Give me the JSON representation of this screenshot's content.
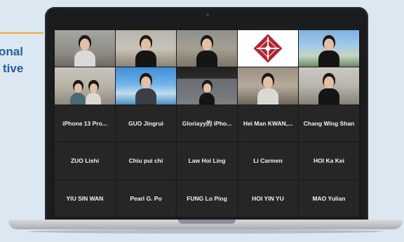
{
  "brand": {
    "line1": "onal",
    "line2": "tive",
    "accent_color": "#1f5fa8",
    "stripe_color": "#f0a830"
  },
  "meeting": {
    "video_tiles": [
      {
        "id": "p1",
        "icon": "participant-video"
      },
      {
        "id": "p2",
        "icon": "participant-video"
      },
      {
        "id": "p3",
        "icon": "participant-video"
      },
      {
        "id": "p4",
        "icon": "university-logo"
      },
      {
        "id": "p5",
        "icon": "participant-video"
      },
      {
        "id": "p6",
        "icon": "participant-video"
      },
      {
        "id": "p7",
        "icon": "participant-video"
      },
      {
        "id": "p8",
        "icon": "participant-video"
      },
      {
        "id": "p9",
        "icon": "participant-video"
      },
      {
        "id": "p10",
        "icon": "participant-video"
      }
    ],
    "name_tiles": [
      {
        "name": "iPhone 13 Pro..."
      },
      {
        "name": "GUO Jingrui"
      },
      {
        "name": "Gloriayy的 iPho..."
      },
      {
        "name": "Hei Man KWAN,..."
      },
      {
        "name": "Chang Wing Shan"
      },
      {
        "name": "ZUO Lishi"
      },
      {
        "name": "Chiu pui chi"
      },
      {
        "name": "Law Hoi Ling"
      },
      {
        "name": "Li Carmen"
      },
      {
        "name": "HOI Ka Kei"
      },
      {
        "name": "YIU SIN WAN"
      },
      {
        "name": "Pearl G. Po"
      },
      {
        "name": "FUNG Lo Ping"
      },
      {
        "name": "HOI YIN YU"
      },
      {
        "name": "MAO Yulian"
      }
    ]
  }
}
